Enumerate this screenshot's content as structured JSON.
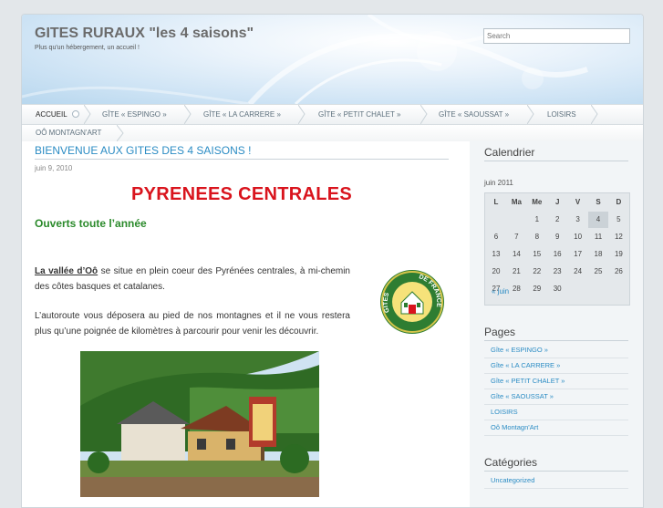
{
  "header": {
    "title": "GITES RURAUX \"les 4 saisons\"",
    "tagline": "Plus qu'un hébergement, un accueil !",
    "search_placeholder": "Search"
  },
  "nav": {
    "items": [
      {
        "label": "ACCUEIL"
      },
      {
        "label": "GÎTE « ESPINGO »"
      },
      {
        "label": "GÎTE « LA CARRERE »"
      },
      {
        "label": "GÎTE « PETIT CHALET »"
      },
      {
        "label": "GÎTE « SAOUSSAT »"
      },
      {
        "label": "LOISIRS"
      },
      {
        "label": "OÔ MONTAGN'ART"
      }
    ]
  },
  "post": {
    "title": "BIENVENUE AUX GITES DES 4 SAISONS !",
    "date": "juin 9, 2010",
    "heading": "PYRENEES CENTRALES",
    "subheading": "Ouverts toute l’année",
    "para1_link": "La vallée d’Oô",
    "para1_rest": " se situe en plein coeur des Pyrénées centrales, à mi-chemin des côtes basques et catalanes.",
    "para2": "L’autoroute vous déposera au pied de nos montagnes et il ne vous restera plus qu’une poignée de kilomètres à parcourir pour venir les découvrir.",
    "logo_text": "GITES DE FRANCE"
  },
  "sidebar": {
    "calendar": {
      "title": "Calendrier",
      "caption": "juin 2011",
      "headers": [
        "L",
        "Ma",
        "Me",
        "J",
        "V",
        "S",
        "D"
      ],
      "weeks": [
        [
          "",
          "",
          "1",
          "2",
          "3",
          "4",
          "5"
        ],
        [
          "6",
          "7",
          "8",
          "9",
          "10",
          "11",
          "12"
        ],
        [
          "13",
          "14",
          "15",
          "16",
          "17",
          "18",
          "19"
        ],
        [
          "20",
          "21",
          "22",
          "23",
          "24",
          "25",
          "26"
        ],
        [
          "27",
          "28",
          "29",
          "30",
          "",
          "",
          ""
        ]
      ],
      "today": "4",
      "prev": "« juin"
    },
    "pages": {
      "title": "Pages",
      "items": [
        "Gîte « ESPINGO »",
        "Gîte « LA CARRERE »",
        "Gîte « PETIT CHALET »",
        "Gîte « SAOUSSAT »",
        "LOISIRS",
        "Oô Montagn'Art"
      ]
    },
    "categories": {
      "title": "Catégories",
      "items": [
        "Uncategorized"
      ]
    }
  },
  "colors": {
    "link": "#2b8cc4",
    "heading_red": "#d9141d",
    "heading_green": "#2b8a2b"
  }
}
